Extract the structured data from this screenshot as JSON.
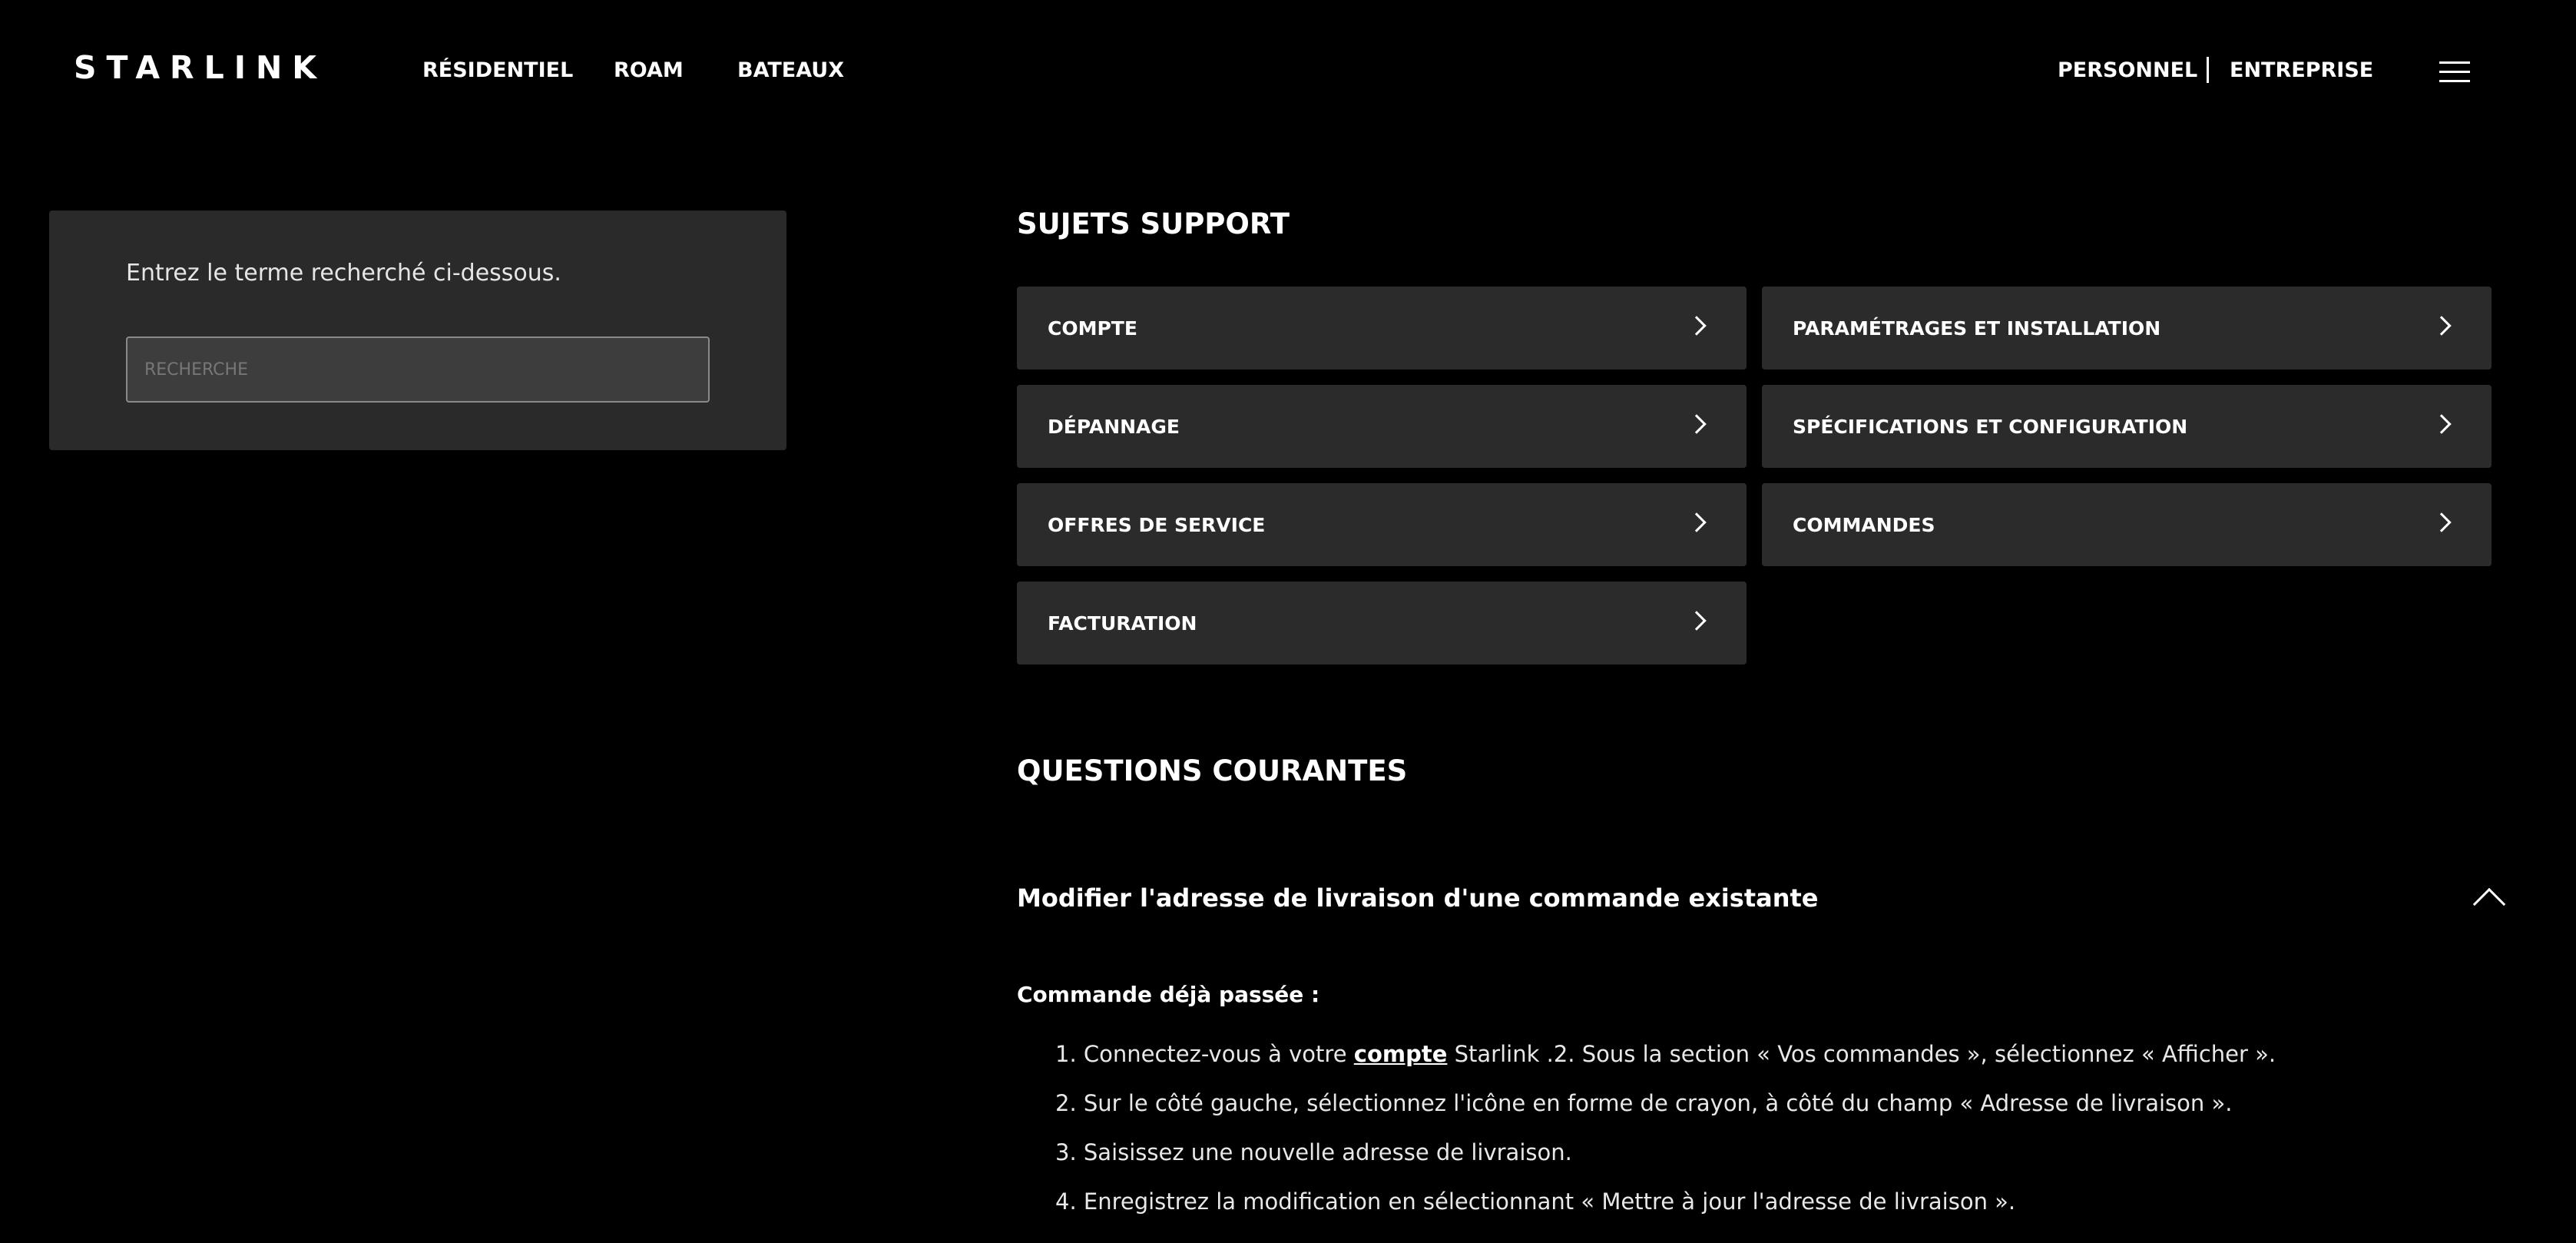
{
  "header": {
    "logo": "STARLINK",
    "nav": [
      "RÉSIDENTIEL",
      "ROAM",
      "BATEAUX"
    ],
    "personnel": "PERSONNEL",
    "entreprise": "ENTREPRISE"
  },
  "search": {
    "prompt": "Entrez le terme recherché ci-dessous.",
    "placeholder": "RECHERCHE",
    "value": ""
  },
  "support": {
    "title": "SUJETS SUPPORT",
    "topics": [
      "COMPTE",
      "PARAMÉTRAGES ET INSTALLATION",
      "DÉPANNAGE",
      "SPÉCIFICATIONS ET CONFIGURATION",
      "OFFRES DE SERVICE",
      "COMMANDES",
      "FACTURATION"
    ]
  },
  "faq": {
    "title": "QUESTIONS COURANTES",
    "question": "Modifier l'adresse de livraison d'une commande existante",
    "subhead": "Commande déjà passée :",
    "step1_before": "1. Connectez-vous à votre ",
    "step1_link": "compte",
    "step1_after": " Starlink .2. Sous la section « Vos commandes », sélectionnez « Afficher ».",
    "steps": [
      "2. Sur le côté gauche, sélectionnez l'icône en forme de crayon, à côté du champ « Adresse de livraison ».",
      "3. Saisissez une nouvelle adresse de livraison.",
      "4. Enregistrez la modification en sélectionnant « Mettre à jour l'adresse de livraison »."
    ]
  }
}
